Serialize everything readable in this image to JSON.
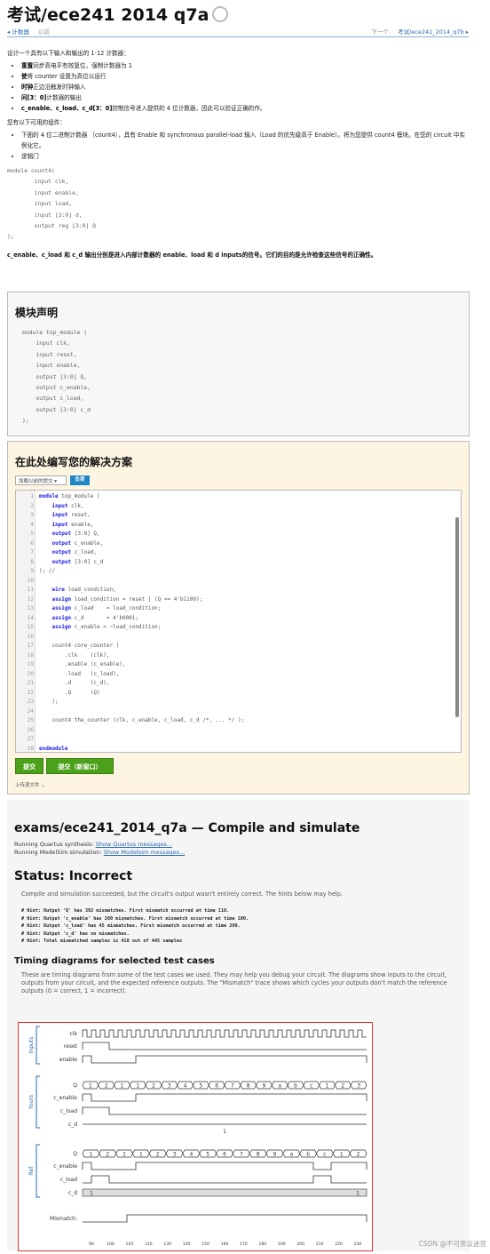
{
  "title": "考试/ece241 2014 q7a",
  "nav": {
    "left_link": "◂ 计数器",
    "left_muted": "以前",
    "right_muted": "下一个",
    "right_link": "考试/ece241_2014_q7b ▸"
  },
  "intro": {
    "lead": "设计一个具有以下输入和输出的 1-12 计数器：",
    "bullets": [
      {
        "bold": "重置",
        "text": "同步高电平有效复位，强制计数器为 1"
      },
      {
        "bold": "使",
        "text": "将 counter 设置为高位以运行"
      },
      {
        "bold": "时钟",
        "text": "正边沿触发时钟输入"
      },
      {
        "bold": "问[3：0]",
        "text": "计数器的输出"
      },
      {
        "bold": "c_enable、c_load、c_d[3：0]",
        "text": "控制信号进入提供的 4 位计数器，因此可以验证正确的作。"
      }
    ],
    "have_lead": "您有以下可用的组件：",
    "have_bullets": [
      "下面的 4 位二进制计数器 （count4），具有 Enable 和 synchronous parallel-load 输入（Load 的优先级高于 Enable）。将为您提供 count4 模块。在您的 circuit 中实例化它。",
      "逻辑门"
    ],
    "count4_code": "module count4(\n        input clk,\n        input enable,\n        input load,\n        input [3:0] d,\n        output reg [3:0] Q\n);",
    "footer": "c_enable、c_load 和 c_d 输出分别是进入内部计数器的 enable、load 和 d inputs的信号。它们的目的是允许检查这些信号的正确性。"
  },
  "module_panel": {
    "heading": "模块声明",
    "code": "module top_module (\n    input clk,\n    input reset,\n    input enable,\n    output [3:0] Q,\n    output c_enable,\n    output c_load,\n    output [3:0] c_d\n);"
  },
  "solution_panel": {
    "heading": "在此处编写您的解决方案",
    "select_value": "加载以前的提交 ▾",
    "load_button": "负荷",
    "lines": [
      "module top_module (",
      "    input clk,",
      "    input reset,",
      "    input enable,",
      "    output [3:0] Q,",
      "    output c_enable,",
      "    output c_load,",
      "    output [3:0] c_d",
      "); //",
      "",
      "    wire load_condition;",
      "    assign load_condition = reset | (Q == 4'b1100);",
      "    assign c_load    = load_condition;",
      "    assign c_d       = 4'b0001;",
      "    assign c_enable = ~load_condition;",
      "",
      "    count4 core_counter (",
      "        .clk    (clk),",
      "        .enable (c_enable),",
      "        .load   (c_load),",
      "        .d      (c_d),",
      "        .Q      (Q)",
      "    );",
      "",
      "    count4 the_counter (clk, c_enable, c_load, c_d /*, ... */ );",
      "",
      "",
      "endmodule",
      ""
    ],
    "submit": "提交",
    "submit_new": "提交（新窗口）",
    "upload": "上传源文件  ⌄"
  },
  "result_panel": {
    "heading": "exams/ece241_2014_q7a — Compile and simulate",
    "quartus_label": "Running Quartus synthesis:",
    "quartus_link": "Show Quartus messages...",
    "modelsim_label": "Running ModelSim simulation:",
    "modelsim_link": "Show Modelsim messages...",
    "status": "Status: Incorrect",
    "status_desc": "Compile and simulation succeeded, but the circuit's output wasn't entirely correct. The hints below may help.",
    "hints": [
      "# Hint: Output 'Q' has 392 mismatches. First mismatch occurred at time 110.",
      "# Hint: Output 'c_enable' has 200 mismatches. First mismatch occurred at time 100.",
      "# Hint: Output 'c_load' has 45 mismatches. First mismatch occurred at time 200.",
      "# Hint: Output 'c_d' has no mismatches.",
      "# Hint: Total mismatched samples is 410 out of 445 samples"
    ],
    "timing_heading": "Timing diagrams for selected test cases",
    "timing_desc": "These are timing diagrams from some of the test cases we used. They may help you debug your circuit. The diagrams show inputs to the circuit, outputs from your circuit, and the expected reference outputs. The \"Mismatch\" trace shows which cycles your outputs don't match the reference outputs (0 = correct, 1 = incorrect)."
  },
  "timing": {
    "group_labels": [
      "Inputs",
      "Yours",
      "Ref"
    ],
    "signals": {
      "inputs": [
        "clk",
        "reset",
        "enable"
      ],
      "yours": [
        "Q",
        "c_enable",
        "c_load",
        "c_d"
      ],
      "ref": [
        "Q",
        "c_enable",
        "c_load",
        "c_d"
      ],
      "mismatch": "Mismatch:"
    },
    "yours_q": [
      "1",
      "2",
      "1",
      "1",
      "2",
      "3",
      "4",
      "5",
      "6",
      "7",
      "8",
      "9",
      "a",
      "b",
      "c",
      "1",
      "2",
      "3"
    ],
    "ref_q": [
      "1",
      "2",
      "1",
      "1",
      "2",
      "3",
      "4",
      "5",
      "6",
      "7",
      "8",
      "9",
      "a",
      "b",
      "c",
      "1",
      "2"
    ],
    "yours_cd": "1",
    "ref_cd": [
      "1",
      "1"
    ],
    "time_ticks": [
      "90",
      "100",
      "110",
      "120",
      "130",
      "140",
      "150",
      "160",
      "170",
      "180",
      "190",
      "200",
      "210",
      "220",
      "230"
    ]
  },
  "watermark": "CSDN @不可思议迷宫"
}
